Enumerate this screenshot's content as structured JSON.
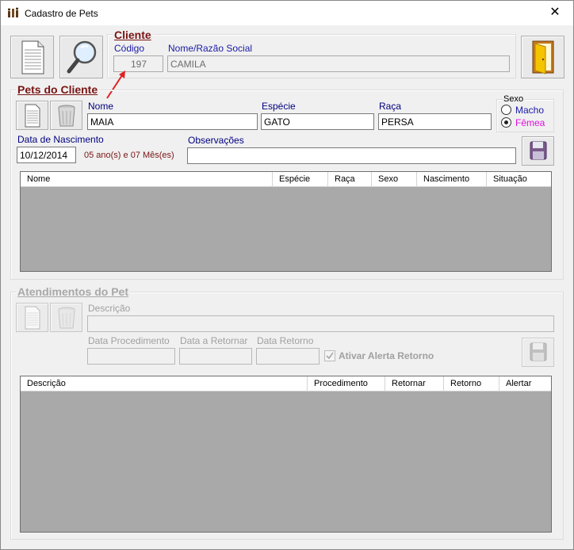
{
  "window": {
    "title": "Cadastro de Pets",
    "close_glyph": "✕",
    "icon": "pets-app-icon"
  },
  "toolbar": {
    "new_icon": "new-document-icon",
    "search_icon": "magnifier-icon",
    "exit_icon": "exit-door-icon"
  },
  "cliente": {
    "legend": "Cliente",
    "codigo_label": "Código",
    "codigo_value": "197",
    "nome_label": "Nome/Razão Social",
    "nome_value": "CAMILA"
  },
  "pets": {
    "legend": "Pets do Cliente",
    "nome_label": "Nome",
    "nome_value": "MAIA",
    "especie_label": "Espécie",
    "especie_value": "GATO",
    "raca_label": "Raça",
    "raca_value": "PERSA",
    "sexo_label": "Sexo",
    "sexo_options": [
      "Macho",
      "Fêmea"
    ],
    "sexo_selected": "Fêmea",
    "nascimento_label": "Data de Nascimento",
    "nascimento_value": "10/12/2014",
    "idade_text": "05 ano(s) e 07 Mês(es)",
    "observacoes_label": "Observações",
    "observacoes_value": "",
    "grid_columns": [
      "Nome",
      "Espécie",
      "Raça",
      "Sexo",
      "Nascimento",
      "Situação"
    ]
  },
  "atendimentos": {
    "legend": "Atendimentos do Pet",
    "descricao_label": "Descrição",
    "descricao_value": "",
    "data_proc_label": "Data Procedimento",
    "data_retornar_label": "Data a Retornar",
    "data_retorno_label": "Data Retorno",
    "alerta_label": "Ativar Alerta Retorno",
    "alerta_checked": true,
    "grid_columns": [
      "Descrição",
      "Procedimento",
      "Retornar",
      "Retorno",
      "Alertar"
    ]
  },
  "colors": {
    "legend": "#7a1414",
    "label": "#1a1aa6",
    "female": "#e010e0",
    "age": "#7a1414",
    "arrow": "#e02020",
    "grid_bg": "#a9a9a9"
  }
}
